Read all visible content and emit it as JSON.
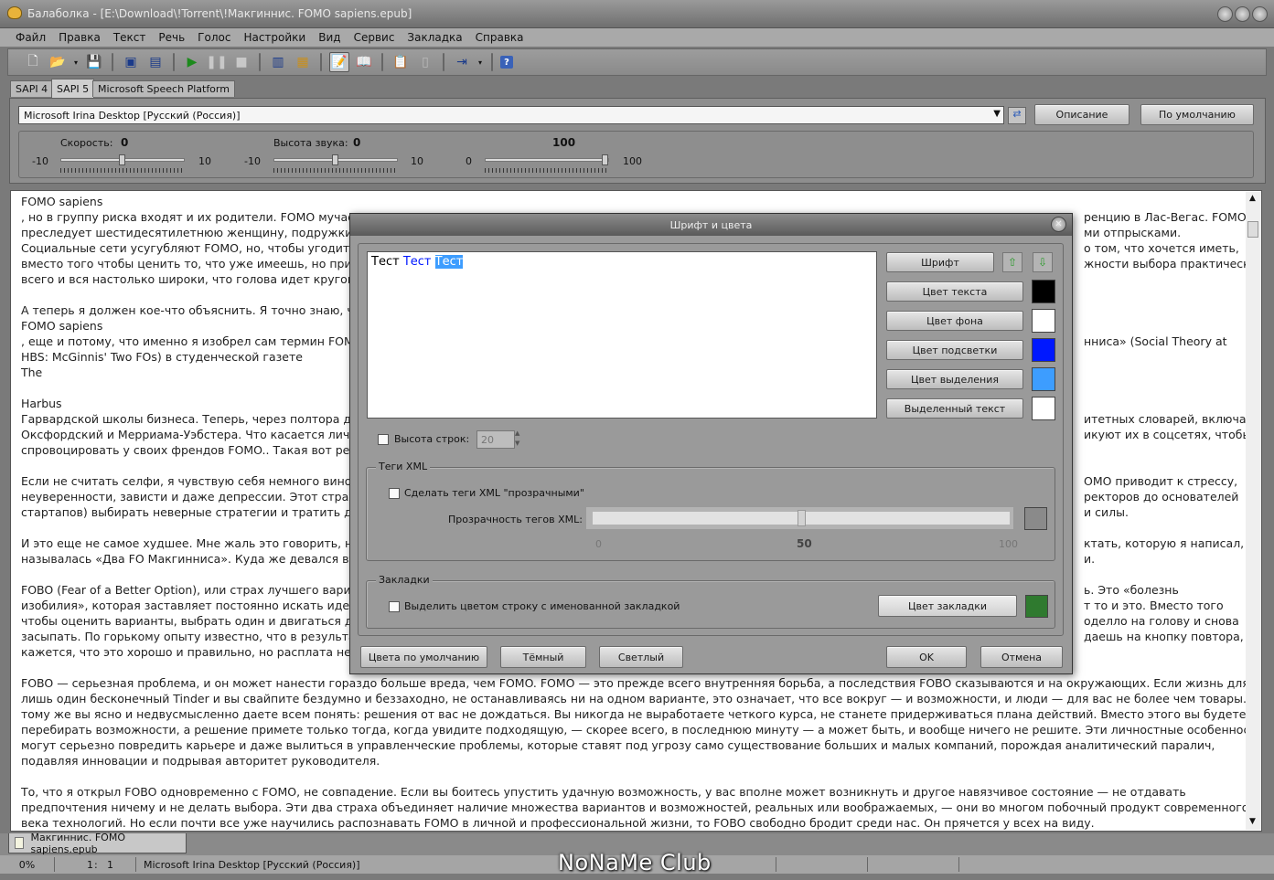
{
  "window": {
    "title": "Балаболка - [E:\\Download\\!Torrent\\!Макгиннис. FOMO sapiens.epub]",
    "controls": [
      "minimize",
      "maximize",
      "close"
    ]
  },
  "menu": [
    "Файл",
    "Правка",
    "Текст",
    "Речь",
    "Голос",
    "Настройки",
    "Вид",
    "Сервис",
    "Закладка",
    "Справка"
  ],
  "toolbar_icons": [
    "new-file-icon",
    "open-folder-icon",
    "dropdown-arrow-icon",
    "save-icon",
    "save-audio-icon",
    "batch-icon",
    "play-icon",
    "pause-icon",
    "stop-icon",
    "split-icon",
    "convert-icon",
    "text-icon",
    "book-icon",
    "clipboard-icon",
    "lock-icon",
    "export-icon",
    "dropdown-arrow-icon",
    "help-icon"
  ],
  "engine_tabs": [
    "SAPI 4",
    "SAPI 5",
    "Microsoft Speech Platform"
  ],
  "voice_panel": {
    "voice": "Microsoft Irina Desktop [Русский (Россия)]",
    "description_button": "Описание",
    "default_button": "По умолчанию",
    "speed": {
      "label": "Скорость:",
      "value": "0",
      "min": "-10",
      "max": "10",
      "fraction": 0.5
    },
    "pitch": {
      "label": "Высота звука:",
      "value": "0",
      "min": "-10",
      "max": "10",
      "fraction": 0.5
    },
    "volume": {
      "value": "100",
      "min": "0",
      "max": "100",
      "fraction": 1.0
    }
  },
  "text_lines": [
    "FOMO sapiens",
    ", но в группу риска входят и их родители. FOMO мучает",
    "преследует шестидесятилетнюю женщину, подружки ко",
    "Социальные сети усугубляют FOMO, но, чтобы угодить",
    "вместо того чтобы ценить то, что уже имеешь, но прини",
    "всего и вся настолько широки, что голова идет кругом.",
    "",
    "А теперь я должен кое-что объяснить. Я точно знаю, чт",
    "FOMO sapiens",
    ", еще и потому, что именно я изобрел сам термин FOMO",
    "HBS: McGinnis' Two FOs) в студенческой газете",
    "The",
    "",
    "Harbus",
    "Гарвардской школы бизнеса. Теперь, через полтора де",
    "Оксфордский и Мерриама-Уэбстера. Что касается лич",
    "спровоцировать у своих френдов FOMO.. Такая вот ре",
    "",
    "Если не считать селфи, я чувствую себя немного вино",
    "неуверенности, зависти и даже депрессии. Этот страх",
    "стартапов) выбирать неверные стратегии и тратить др",
    "",
    "И это еще не самое худшее. Мне жаль это говорить, но",
    "называлась «Два FO Макгинниса». Куда же девался вто",
    "",
    "FOBO (Fear of a Better Option), или страх лучшего вариан",
    "изобилия», которая заставляет постоянно искать идеа",
    "чтобы оценить варианты, выбрать один и двигаться да",
    "засыпать. По горькому опыту известно, что в результа",
    "кажется, что это хорошо и правильно, но расплата нем"
  ],
  "text_lines_right": [
    "",
    "ренцию в Лас-Вегас. FOMO",
    "ми отпрысками.",
    "о том, что хочется иметь,",
    "жности выбора практически",
    "",
    "",
    "",
    "",
    "нниса» (Social Theory at",
    "",
    "",
    "",
    "",
    "итетных словарей, включая",
    "икуют их в соцсетях, чтобы",
    "",
    "",
    "ОМО приводит к стрессу,",
    "ректоров до основателей",
    "и силы.",
    "",
    "ктать, которую я написал,",
    "и.",
    "",
    "ь. Это «болезнь",
    "т то и это. Вместо того",
    "оделло на голову и снова",
    "даешь на кнопку повтора,",
    ""
  ],
  "text_bottom": [
    "FOBO — серьезная проблема, и он может нанести гораздо больше вреда, чем FOMO. FOMO — это прежде всего внутренняя борьба, а последствия FOBO сказываются и на окружающих. Если жизнь для вас",
    "лишь один бесконечный Tinder и вы свайпите бездумно и беззаходно, не останавливаясь ни на одном варианте, это означает, что все вокруг — и возможности, и люди — для вас не более чем товары. К",
    "тому же вы ясно и недвусмысленно даете всем понять: решения от вас не дождаться. Вы никогда не выработаете четкого курса, не станете придерживаться плана действий. Вместо этого вы будете",
    "перебирать возможности, а решение примете только тогда, когда увидите подходящую, — скорее всего, в последнюю минуту — а может быть, и вообще ничего не решите. Эти личностные особенности",
    "могут серьезно повредить карьере и даже вылиться в управленческие проблемы, которые ставят под угрозу само существование больших и малых компаний, порождая аналитический паралич,",
    "подавляя инновации и подрывая авторитет руководителя.",
    "",
    "То, что я открыл FOBO одновременно с FOMO, не совпадение. Если вы боитесь упустить удачную возможность, у вас вполне может возникнуть и другое навязчивое состояние — не отдавать",
    "предпочтения ничему и не делать выбора. Эти два страха объединяет наличие множества вариантов и возможностей, реальных или воображаемых, — они во многом побочный продукт современного",
    "века технологий. Но если почти все уже научились распознавать FOMO в личной и профессиональной жизни, то FOBO свободно бродит среди нас. Он прячется у всех на виду."
  ],
  "doc_tab": "Макгиннис. FOMO sapiens.epub",
  "status": {
    "percent": "0%",
    "line": "1",
    "col": "1",
    "voice": "Microsoft Irina Desktop [Русский (Россия)]"
  },
  "watermark": "NoNaMe Club",
  "dialog": {
    "title": "Шрифт и цвета",
    "preview": {
      "normal": "Тест",
      "highlight": "Тест",
      "selected": "Тест"
    },
    "font_button": "Шрифт",
    "text_color_button": "Цвет текста",
    "bg_color_button": "Цвет фона",
    "highlight_color_button": "Цвет подсветки",
    "selection_color_button": "Цвет выделения",
    "selected_text_button": "Выделенный текст",
    "colors": {
      "text": "#000000",
      "background": "#ffffff",
      "highlight": "#0018ff",
      "selection": "#3d9dff",
      "selected_text": "#ffffff",
      "xml_tags": "#8a8a8a",
      "bookmark": "#2f7a2f"
    },
    "line_height_label": "Высота строк:",
    "line_height_value": "20",
    "xml_group": "Теги XML",
    "xml_transparent_label": "Сделать теги XML \"прозрачными\"",
    "xml_opacity_label": "Прозрачность тегов XML:",
    "xml_opacity": {
      "min": "0",
      "mid": "50",
      "max": "100",
      "value": 50
    },
    "bookmarks_group": "Закладки",
    "bookmark_highlight_label": "Выделить цветом строку с именованной закладкой",
    "bookmark_color_button": "Цвет закладки",
    "default_colors_button": "Цвета по умолчанию",
    "dark_button": "Тёмный",
    "light_button": "Светлый",
    "ok_button": "OK",
    "cancel_button": "Отмена"
  }
}
